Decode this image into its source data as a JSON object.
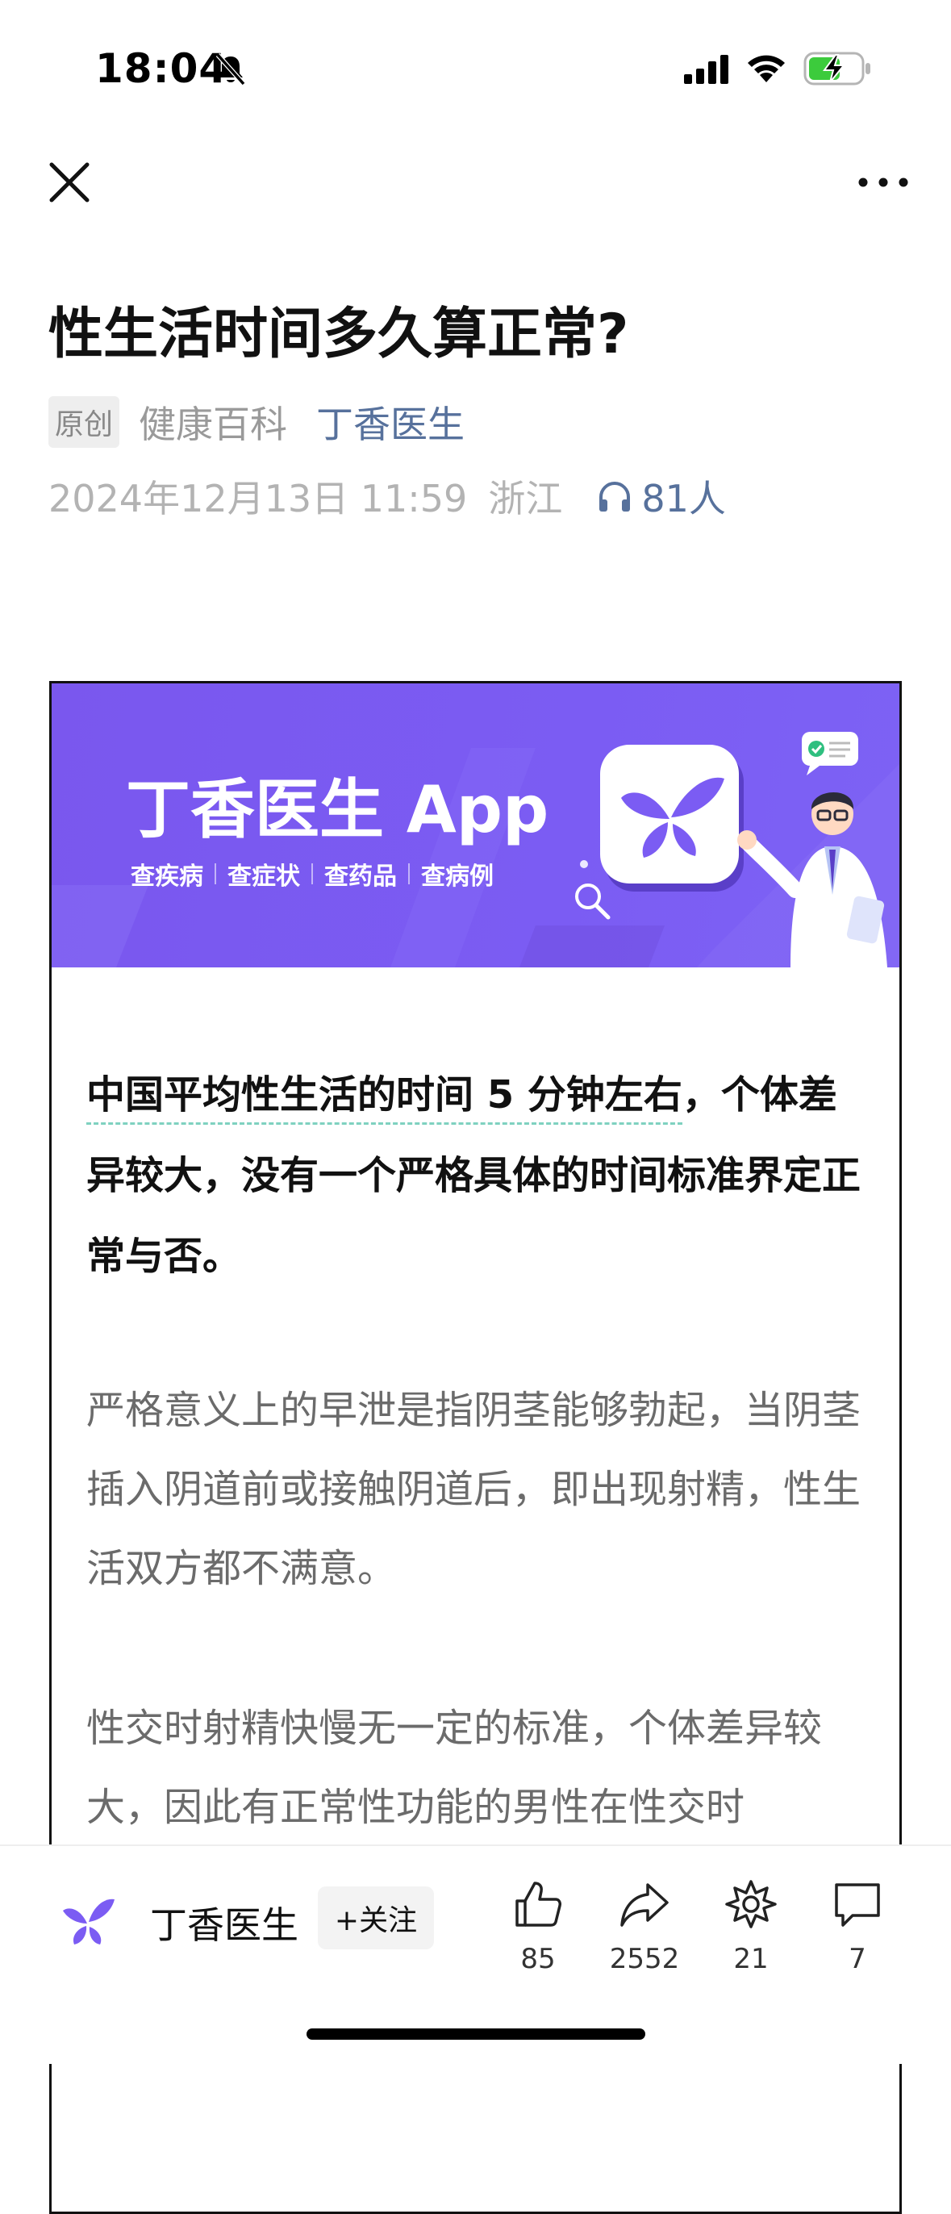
{
  "status_bar": {
    "time": "18:04",
    "icons": [
      "bell-slash-icon",
      "cellular-signal-icon",
      "wifi-icon",
      "battery-charging-icon"
    ]
  },
  "nav": {
    "icons": [
      "close-icon",
      "more-icon"
    ]
  },
  "article": {
    "title": "性生活时间多久算正常?",
    "original_badge": "原创",
    "category": "健康百科",
    "author": "丁香医生",
    "date": "2024年12月13日 11:59",
    "location": "浙江",
    "listeners": "81人"
  },
  "banner": {
    "title": "丁香医生 App",
    "tags": [
      "查疾病",
      "查症状",
      "查药品",
      "查病例"
    ]
  },
  "content": {
    "lead_highlight": "中国平均性生活的时间 5 分钟左右",
    "lead_rest": "，个体差异较大，没有一个严格具体的时间标准界定正常与否。",
    "paragraph_2": "严格意义上的早泄是指阴茎能够勃起，当阴茎插入阴道前或接触阴道后，即出现射精，性生活双方都不满意。",
    "paragraph_3": "性交时射精快慢无一定的标准，个体差异较大，因此有正常性功能的男性在性交时"
  },
  "bottom_bar": {
    "author_name": "丁香医生",
    "follow_label": "+关注",
    "likes": "85",
    "shares": "2552",
    "collects": "21",
    "comments": "7"
  },
  "colors": {
    "banner": "#7b5cf3",
    "link": "#57719c",
    "brand": "#7b5cf3"
  }
}
